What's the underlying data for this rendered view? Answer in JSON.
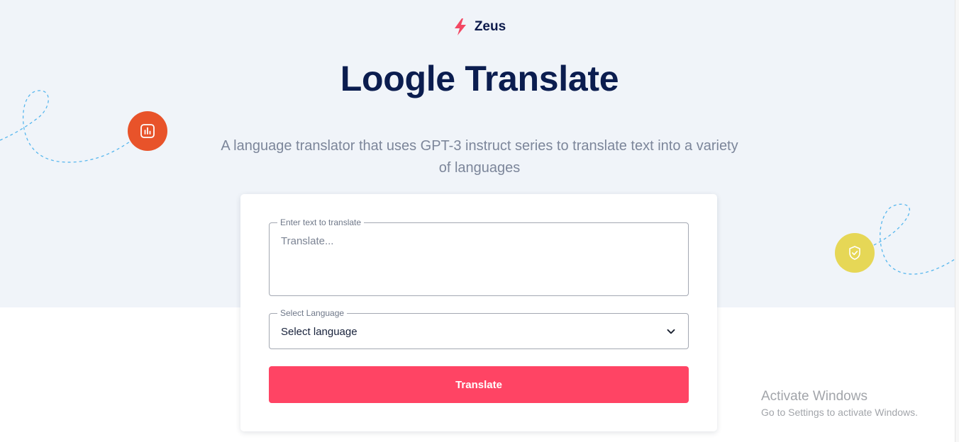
{
  "brand": {
    "name": "Zeus",
    "icon": "lightning-bolt-icon",
    "icon_color": "#f34863"
  },
  "hero": {
    "title": "Loogle Translate",
    "subtitle": "A language translator that uses GPT-3 instruct series to translate text into a variety of languages"
  },
  "decor": {
    "left_badge": {
      "icon": "bar-chart-icon",
      "color": "#e8532a"
    },
    "right_badge": {
      "icon": "shield-check-icon",
      "color": "#e6d756"
    }
  },
  "form": {
    "text_field": {
      "label": "Enter text to translate",
      "placeholder": "Translate...",
      "value": ""
    },
    "language_field": {
      "label": "Select Language",
      "value": "Select language"
    },
    "submit_label": "Translate"
  },
  "watermark": {
    "title": "Activate Windows",
    "subtitle": "Go to Settings to activate Windows."
  },
  "colors": {
    "hero_background": "#f0f4f9",
    "title": "#0b1d4f",
    "button": "#ff4464"
  }
}
